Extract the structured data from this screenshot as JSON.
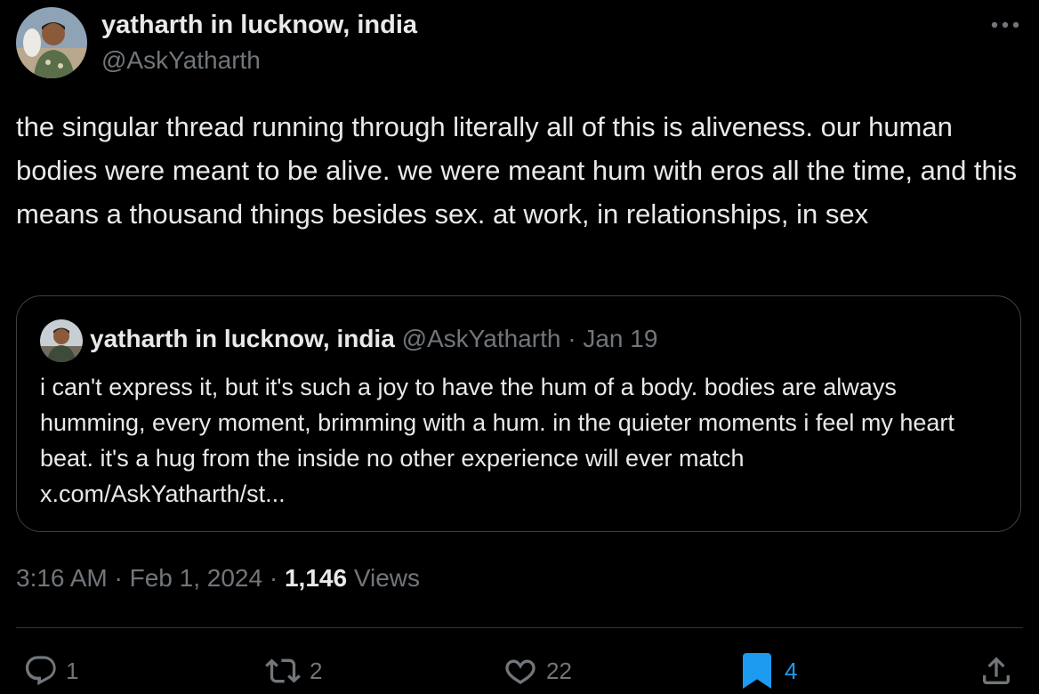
{
  "author": {
    "display_name": "yatharth in lucknow, india",
    "handle": "@AskYatharth"
  },
  "tweet": {
    "text": "the singular thread running through literally all of this is aliveness. our human bodies were meant to be alive. we were meant hum with eros all the time, and this means a thousand things besides sex. at work, in relationships, in sex",
    "time": "3:16 AM",
    "date": "Feb 1, 2024",
    "views_count": "1,146",
    "views_label": "Views",
    "separator": "·"
  },
  "quote": {
    "display_name": "yatharth in lucknow, india",
    "handle": "@AskYatharth",
    "date": "Jan 19",
    "separator": "·",
    "text": "i can't express it, but it's such a joy to have the hum of a body. bodies are always humming, every moment, brimming with a hum. in the quieter moments i feel my heart beat. it's a hug from the inside no other experience will ever match x.com/AskYatharth/st..."
  },
  "actions": {
    "replies": "1",
    "reposts": "2",
    "likes": "22",
    "bookmarks": "4"
  },
  "icons": {
    "reply": "reply-icon",
    "repost": "repost-icon",
    "like": "heart-icon",
    "bookmark": "bookmark-icon",
    "share": "share-icon",
    "more": "more-icon"
  },
  "colors": {
    "background": "#000000",
    "primary_text": "#e7e9ea",
    "secondary_text": "#71767b",
    "accent": "#1d9bf0",
    "border": "#2f3336"
  }
}
